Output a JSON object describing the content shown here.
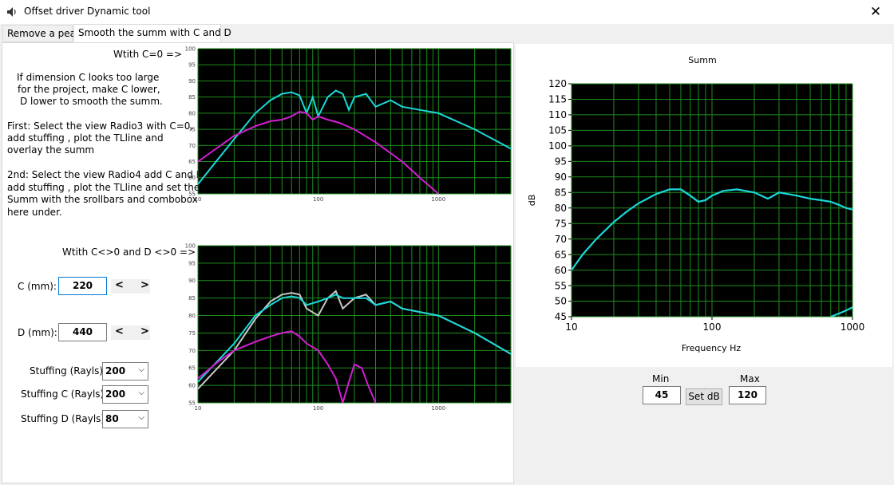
{
  "window": {
    "title": "Offset driver Dynamic tool",
    "close_glyph": "✕",
    "icon": "speaker-icon"
  },
  "tabs": [
    {
      "label": "Remove a peak",
      "active": false
    },
    {
      "label": "Smooth the summ with C and D",
      "active": true
    }
  ],
  "labels": {
    "with_c0": "Wtith C=0 =>",
    "with_cd": "Wtith C<>0 and D <>0 =>",
    "intro": [
      "If dimension C looks too large",
      "for the project, make C lower,",
      "D lower to smooth the summ."
    ],
    "first": [
      "First: Select the view Radio3 with C=0,",
      "add stuffing , plot the TLline and",
      "overlay the summ"
    ],
    "second": [
      "2nd: Select the view Radio4 add C and D,",
      "add stuffing , plot the TLline and set the",
      "Summ with the srollbars and combobox",
      "here under."
    ]
  },
  "fields": {
    "c_label": "C (mm):",
    "c_value": "220",
    "d_label": "D (mm):",
    "d_value": "440",
    "scroll_left": "<",
    "scroll_right": ">"
  },
  "stuffing": [
    {
      "label": "Stuffing (Rayls):",
      "value": "200"
    },
    {
      "label": "Stuffing C (Rayls):",
      "value": "200"
    },
    {
      "label": "Stuffing D (Rayls):",
      "value": "80"
    }
  ],
  "small_plot_axes": {
    "y_ticks": [
      "100",
      "95",
      "90",
      "85",
      "80",
      "75",
      "70",
      "65",
      "60",
      "55"
    ],
    "x_ticks": [
      "10",
      "100",
      "1000"
    ]
  },
  "summ_chart": {
    "title": "Summ",
    "xlabel": "Frequency Hz",
    "ylabel": "dB",
    "y_ticks": [
      "120",
      "115",
      "110",
      "105",
      "100",
      "95",
      "90",
      "85",
      "80",
      "75",
      "70",
      "65",
      "60",
      "55",
      "50",
      "45"
    ],
    "x_ticks": [
      "10",
      "100",
      "1000"
    ]
  },
  "db_controls": {
    "min_label": "Min",
    "min_value": "45",
    "max_label": "Max",
    "max_value": "120",
    "set_label": "Set dB"
  },
  "colors": {
    "cyan": "#19d9d9",
    "magenta": "#d21ed2",
    "grid": "#1e8c1e",
    "gray": "#c8c8c8"
  },
  "chart_data": [
    {
      "type": "line",
      "title": "",
      "xscale": "log",
      "xlim": [
        10,
        4000
      ],
      "ylim": [
        55,
        100
      ],
      "series": [
        {
          "color": "cyan",
          "x": [
            10,
            20,
            30,
            40,
            50,
            60,
            70,
            80,
            90,
            100,
            120,
            140,
            160,
            180,
            200,
            250,
            300,
            400,
            500,
            700,
            1000,
            2000,
            4000
          ],
          "y": [
            58,
            72,
            80,
            84,
            86,
            86.5,
            85.5,
            80,
            85,
            79,
            85,
            87,
            86,
            81,
            85,
            86,
            82,
            84,
            82,
            81,
            80,
            75,
            69
          ]
        },
        {
          "color": "magenta",
          "x": [
            10,
            20,
            30,
            40,
            50,
            60,
            70,
            80,
            90,
            100,
            120,
            150,
            200,
            300,
            500,
            700,
            1000
          ],
          "y": [
            65,
            73,
            76,
            77.5,
            78,
            79,
            80.5,
            80,
            78,
            79,
            78,
            77,
            75,
            71,
            65,
            60,
            55
          ]
        }
      ]
    },
    {
      "type": "line",
      "title": "",
      "xscale": "log",
      "xlim": [
        10,
        4000
      ],
      "ylim": [
        55,
        100
      ],
      "series": [
        {
          "color": "gray",
          "x": [
            10,
            20,
            30,
            40,
            50,
            60,
            70,
            80,
            100,
            120,
            140,
            160,
            200,
            250,
            300,
            400,
            500,
            700,
            1000,
            2000,
            4000
          ],
          "y": [
            59,
            70,
            79,
            84,
            86,
            86.5,
            86,
            82,
            80,
            85,
            87,
            82,
            85,
            86,
            83,
            84,
            82,
            81,
            80,
            75,
            69
          ]
        },
        {
          "color": "cyan",
          "x": [
            10,
            20,
            30,
            40,
            50,
            60,
            70,
            80,
            100,
            120,
            140,
            160,
            200,
            250,
            300,
            400,
            500,
            700,
            1000,
            2000,
            4000
          ],
          "y": [
            61,
            72,
            80,
            83,
            85,
            85.5,
            85,
            83,
            84,
            85,
            86,
            85,
            85,
            85,
            83,
            84,
            82,
            81,
            80,
            75,
            69
          ]
        },
        {
          "color": "magenta",
          "x": [
            10,
            15,
            20,
            30,
            40,
            50,
            60,
            70,
            80,
            100,
            120,
            140,
            160,
            180,
            200,
            230,
            260,
            300,
            350
          ],
          "y": [
            62,
            67,
            70,
            72.5,
            74,
            75,
            75.5,
            74,
            72,
            70,
            66,
            62,
            55,
            61,
            66,
            65,
            60,
            55,
            50
          ]
        }
      ]
    },
    {
      "type": "line",
      "title": "Summ",
      "xlabel": "Frequency Hz",
      "ylabel": "dB",
      "xscale": "log",
      "xlim": [
        10,
        1000
      ],
      "ylim": [
        45,
        120
      ],
      "series": [
        {
          "color": "cyan",
          "x": [
            10,
            12,
            15,
            20,
            25,
            30,
            40,
            50,
            60,
            70,
            80,
            90,
            100,
            120,
            150,
            200,
            250,
            300,
            400,
            500,
            600,
            700,
            800,
            900,
            1000
          ],
          "y": [
            60,
            65,
            70,
            75.5,
            79,
            81.5,
            84.5,
            86,
            86,
            84,
            82,
            82.5,
            84,
            85.5,
            86,
            85,
            83,
            85,
            84,
            83,
            82.5,
            82,
            81,
            80,
            79.5
          ]
        },
        {
          "color": "cyan",
          "x": [
            700,
            800,
            900,
            1000
          ],
          "y": [
            45,
            46,
            47,
            48
          ]
        }
      ]
    }
  ]
}
